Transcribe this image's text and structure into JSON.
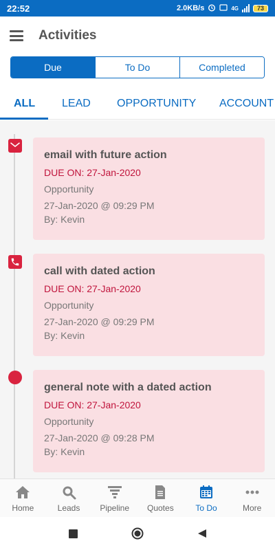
{
  "status_bar": {
    "time": "22:52",
    "speed": "2.0KB/s",
    "alarm_icon": "alarm-icon",
    "network": "4G",
    "battery": "73"
  },
  "app_bar": {
    "title": "Activities",
    "menu_icon": "hamburger-menu-icon"
  },
  "segments": [
    {
      "label": "Due",
      "active": true
    },
    {
      "label": "To Do",
      "active": false
    },
    {
      "label": "Completed",
      "active": false
    }
  ],
  "category_tabs": [
    {
      "label": "ALL",
      "active": true
    },
    {
      "label": "LEAD",
      "active": false
    },
    {
      "label": "OPPORTUNITY",
      "active": false
    },
    {
      "label": "ACCOUNT",
      "active": false
    }
  ],
  "activities": [
    {
      "icon": "email-icon",
      "title": "email with future action",
      "due": "DUE ON: 27-Jan-2020",
      "type": "Opportunity",
      "datetime": "27-Jan-2020 @ 09:29 PM",
      "by": "By: Kevin"
    },
    {
      "icon": "phone-icon",
      "title": "call with dated action",
      "due": "DUE ON: 27-Jan-2020",
      "type": "Opportunity",
      "datetime": "27-Jan-2020 @ 09:29 PM",
      "by": "By: Kevin"
    },
    {
      "icon": "note-dot-icon",
      "title": "general note with a dated action",
      "due": "DUE ON: 27-Jan-2020",
      "type": "Opportunity",
      "datetime": "27-Jan-2020 @ 09:28 PM",
      "by": "By: Kevin"
    }
  ],
  "bottom_nav": [
    {
      "label": "Home",
      "icon": "home-icon",
      "active": false
    },
    {
      "label": "Leads",
      "icon": "leads-search-icon",
      "active": false
    },
    {
      "label": "Pipeline",
      "icon": "pipeline-funnel-icon",
      "active": false
    },
    {
      "label": "Quotes",
      "icon": "quotes-document-icon",
      "active": false
    },
    {
      "label": "To Do",
      "icon": "calendar-icon",
      "active": true
    },
    {
      "label": "More",
      "icon": "more-dots-icon",
      "active": false
    }
  ],
  "colors": {
    "primary": "#0b6cc2",
    "accent_red": "#d9233f",
    "card_bg": "#fadfe3",
    "due_text": "#c0143c"
  }
}
